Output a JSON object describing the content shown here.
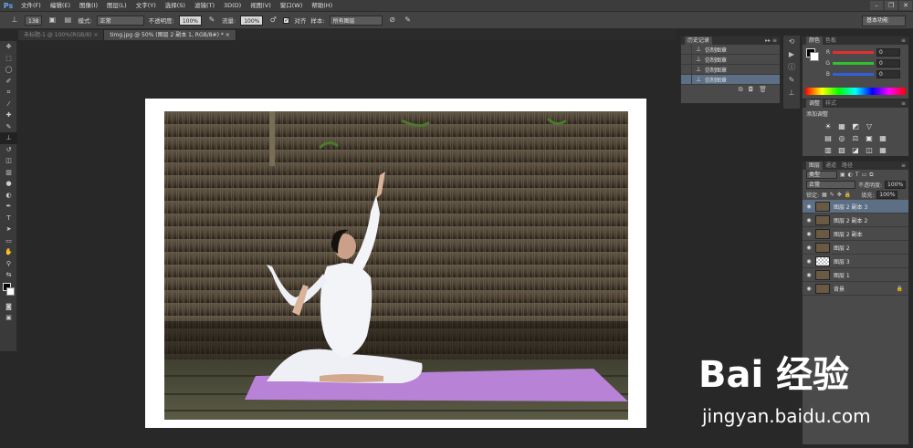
{
  "app": {
    "logo": "Ps"
  },
  "menu": [
    "文件(F)",
    "编辑(E)",
    "图像(I)",
    "图层(L)",
    "文字(Y)",
    "选择(S)",
    "滤镜(T)",
    "3D(D)",
    "视图(V)",
    "窗口(W)",
    "帮助(H)"
  ],
  "window_controls": [
    "–",
    "❐",
    "✕"
  ],
  "options": {
    "brush_size": "138",
    "mode_label": "模式:",
    "mode_value": "正常",
    "opacity_label": "不透明度:",
    "opacity_value": "100%",
    "flow_label": "流量:",
    "flow_value": "100%",
    "aligned_label": "对齐",
    "sample_label": "样本:",
    "sample_value": "所有图层",
    "workspace": "基本功能"
  },
  "tabs": [
    "未标题-1 @ 100%(RGB/8) ×",
    "timg.jpg @ 50% (图层 2 副本 1, RGB/8#) * ×"
  ],
  "history": {
    "tab": "历史记录",
    "items": [
      "仿制图章",
      "仿制图章",
      "仿制图章",
      "仿制图章"
    ],
    "selected_index": 3
  },
  "color": {
    "tab_active": "颜色",
    "tab_other": "色板",
    "channels": [
      {
        "label": "R",
        "value": "0",
        "color": "#e03030"
      },
      {
        "label": "G",
        "value": "0",
        "color": "#30c030"
      },
      {
        "label": "B",
        "value": "0",
        "color": "#3060e0"
      }
    ]
  },
  "adjust": {
    "tab_active": "调整",
    "tab_other": "样式",
    "title": "添加调整",
    "icons": [
      "☀",
      "▦",
      "◩",
      "▽",
      "",
      "▤",
      "◎",
      "⚖",
      "▣",
      "▦",
      "▥",
      "▧",
      "◪",
      "◫",
      "▦"
    ]
  },
  "layers": {
    "tabs": [
      "图层",
      "通道",
      "路径"
    ],
    "kind_label": "类型",
    "blend_value": "正常",
    "opacity_label": "不透明度:",
    "opacity_value": "100%",
    "lock_label": "锁定:",
    "fill_label": "填充:",
    "fill_value": "100%",
    "items": [
      {
        "name": "图层 2 副本 3",
        "thumb": "photo",
        "selected": true
      },
      {
        "name": "图层 2 副本 2",
        "thumb": "photo",
        "selected": false
      },
      {
        "name": "图层 2 副本",
        "thumb": "photo",
        "selected": false
      },
      {
        "name": "图层 2",
        "thumb": "photo",
        "selected": false
      },
      {
        "name": "图层 3",
        "thumb": "transparent",
        "selected": false
      },
      {
        "name": "图层 1",
        "thumb": "photo",
        "selected": false
      },
      {
        "name": "背景",
        "thumb": "photo",
        "selected": false
      }
    ]
  },
  "watermark": {
    "brand": "Bai 经验",
    "site": "jingyan.baidu.com"
  }
}
